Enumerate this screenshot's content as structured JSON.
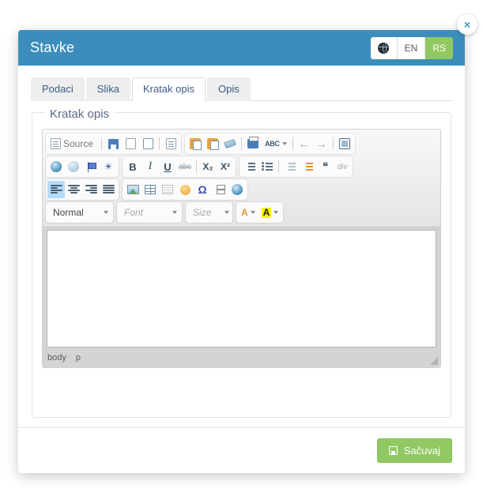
{
  "modal": {
    "title": "Stavke",
    "close_label": "×",
    "languages": [
      {
        "name": "globe",
        "label": "",
        "active": false,
        "icon": "globe-icon"
      },
      {
        "name": "en",
        "label": "EN",
        "active": false
      },
      {
        "name": "rs",
        "label": "RS",
        "active": true
      }
    ],
    "tabs": [
      {
        "label": "Podaci",
        "active": false
      },
      {
        "label": "Slika",
        "active": false
      },
      {
        "label": "Kratak opis",
        "active": true
      },
      {
        "label": "Opis",
        "active": false
      }
    ],
    "fieldset_legend": "Kratak opis",
    "footer": {
      "save_label": "Sačuvaj",
      "save_icon": "floppy-disk-icon"
    }
  },
  "editor": {
    "status_path": "body",
    "status_element": "p",
    "content": "",
    "toolbar": {
      "row1": {
        "group1": [
          {
            "name": "source",
            "label": "Source",
            "icon": "source-icon"
          },
          {
            "name": "new-page",
            "label": "",
            "icon": "new-page-icon"
          },
          {
            "name": "save",
            "label": "",
            "icon": "save-icon"
          },
          {
            "name": "preview",
            "label": "",
            "icon": "preview-icon"
          },
          {
            "name": "templates",
            "label": "",
            "icon": "templates-icon"
          }
        ],
        "group2": [
          {
            "name": "paste",
            "label": "",
            "icon": "paste-icon"
          },
          {
            "name": "paste-from-word",
            "label": "",
            "icon": "paste-word-icon"
          },
          {
            "name": "remove-format",
            "label": "",
            "icon": "eraser-icon"
          },
          {
            "name": "print",
            "label": "",
            "icon": "print-icon"
          },
          {
            "name": "spell-check",
            "label": "",
            "icon": "spellcheck-icon"
          },
          {
            "name": "undo",
            "label": "",
            "icon": "undo-icon"
          },
          {
            "name": "redo",
            "label": "",
            "icon": "redo-icon"
          },
          {
            "name": "maximize",
            "label": "",
            "icon": "maximize-icon"
          }
        ]
      },
      "row2": {
        "group1": [
          {
            "name": "link",
            "label": "",
            "icon": "link-icon"
          },
          {
            "name": "unlink",
            "label": "",
            "icon": "unlink-icon"
          },
          {
            "name": "anchor",
            "label": "",
            "icon": "anchor-flag-icon"
          },
          {
            "name": "find",
            "label": "",
            "icon": "binoculars-icon"
          }
        ],
        "group2": [
          {
            "name": "bold",
            "label": "B",
            "icon": "bold-icon"
          },
          {
            "name": "italic",
            "label": "I",
            "icon": "italic-icon"
          },
          {
            "name": "underline",
            "label": "U",
            "icon": "underline-icon"
          },
          {
            "name": "strike",
            "label": "abc",
            "icon": "strikethrough-icon"
          },
          {
            "name": "subscript",
            "label": "X₂",
            "icon": "subscript-icon"
          },
          {
            "name": "superscript",
            "label": "X²",
            "icon": "superscript-icon"
          }
        ],
        "group3": [
          {
            "name": "numbered-list",
            "label": "",
            "icon": "numbered-list-icon"
          },
          {
            "name": "bulleted-list",
            "label": "",
            "icon": "bulleted-list-icon"
          },
          {
            "name": "outdent",
            "label": "",
            "icon": "outdent-icon"
          },
          {
            "name": "indent",
            "label": "",
            "icon": "indent-icon"
          },
          {
            "name": "blockquote",
            "label": "",
            "icon": "blockquote-icon"
          },
          {
            "name": "create-div",
            "label": "div",
            "icon": "create-div-icon"
          }
        ]
      },
      "row3": {
        "group1": [
          {
            "name": "align-left",
            "label": "",
            "icon": "align-left-icon",
            "active": true
          },
          {
            "name": "align-center",
            "label": "",
            "icon": "align-center-icon",
            "active": false
          },
          {
            "name": "align-right",
            "label": "",
            "icon": "align-right-icon",
            "active": false
          },
          {
            "name": "align-justify",
            "label": "",
            "icon": "align-justify-icon",
            "active": false
          }
        ],
        "group2": [
          {
            "name": "image",
            "label": "",
            "icon": "image-icon"
          },
          {
            "name": "table",
            "label": "",
            "icon": "table-icon"
          },
          {
            "name": "horizontal-rule",
            "label": "",
            "icon": "horizontal-rule-icon"
          },
          {
            "name": "smiley",
            "label": "",
            "icon": "smiley-icon"
          },
          {
            "name": "special-char",
            "label": "Ω",
            "icon": "omega-icon"
          },
          {
            "name": "page-break",
            "label": "",
            "icon": "page-break-icon"
          },
          {
            "name": "iframe",
            "label": "",
            "icon": "iframe-globe-icon"
          }
        ]
      },
      "row4": {
        "format": {
          "name": "paragraph-format",
          "value": "Normal",
          "placeholder": "Normal"
        },
        "font": {
          "name": "font-family",
          "value": "",
          "placeholder": "Font"
        },
        "size": {
          "name": "font-size",
          "value": "",
          "placeholder": "Size"
        },
        "text_color": {
          "name": "text-color",
          "label": "A"
        },
        "bg_color": {
          "name": "background-color",
          "label": "A"
        }
      }
    }
  },
  "colors": {
    "header_blue": "#3c8dbc",
    "accent_green": "#90c862",
    "tab_inactive": "#eeeeee",
    "toolbar_bg": "#e9e9e9",
    "editor_chrome": "#d4d4d4",
    "link_text": "#3c5b85"
  }
}
